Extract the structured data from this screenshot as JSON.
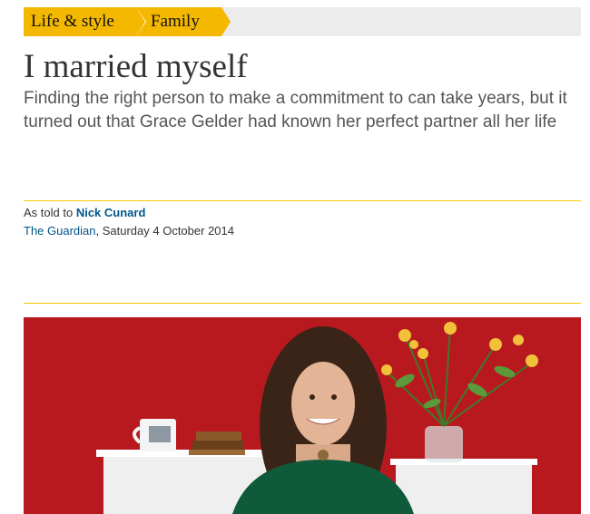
{
  "breadcrumb": {
    "section": "Life & style",
    "subsection": "Family",
    "accent_color": "#f5b800"
  },
  "article": {
    "headline": "I married myself",
    "standfirst": "Finding the right person to make a commitment to can take years, but it turned out that Grace Gelder had known her perfect partner all her life",
    "byline_prefix": "As told to ",
    "author": "Nick Cunard",
    "publication": "The Guardian",
    "date": ", Saturday 4 October 2014"
  },
  "image": {
    "background_color": "#b3161b"
  }
}
